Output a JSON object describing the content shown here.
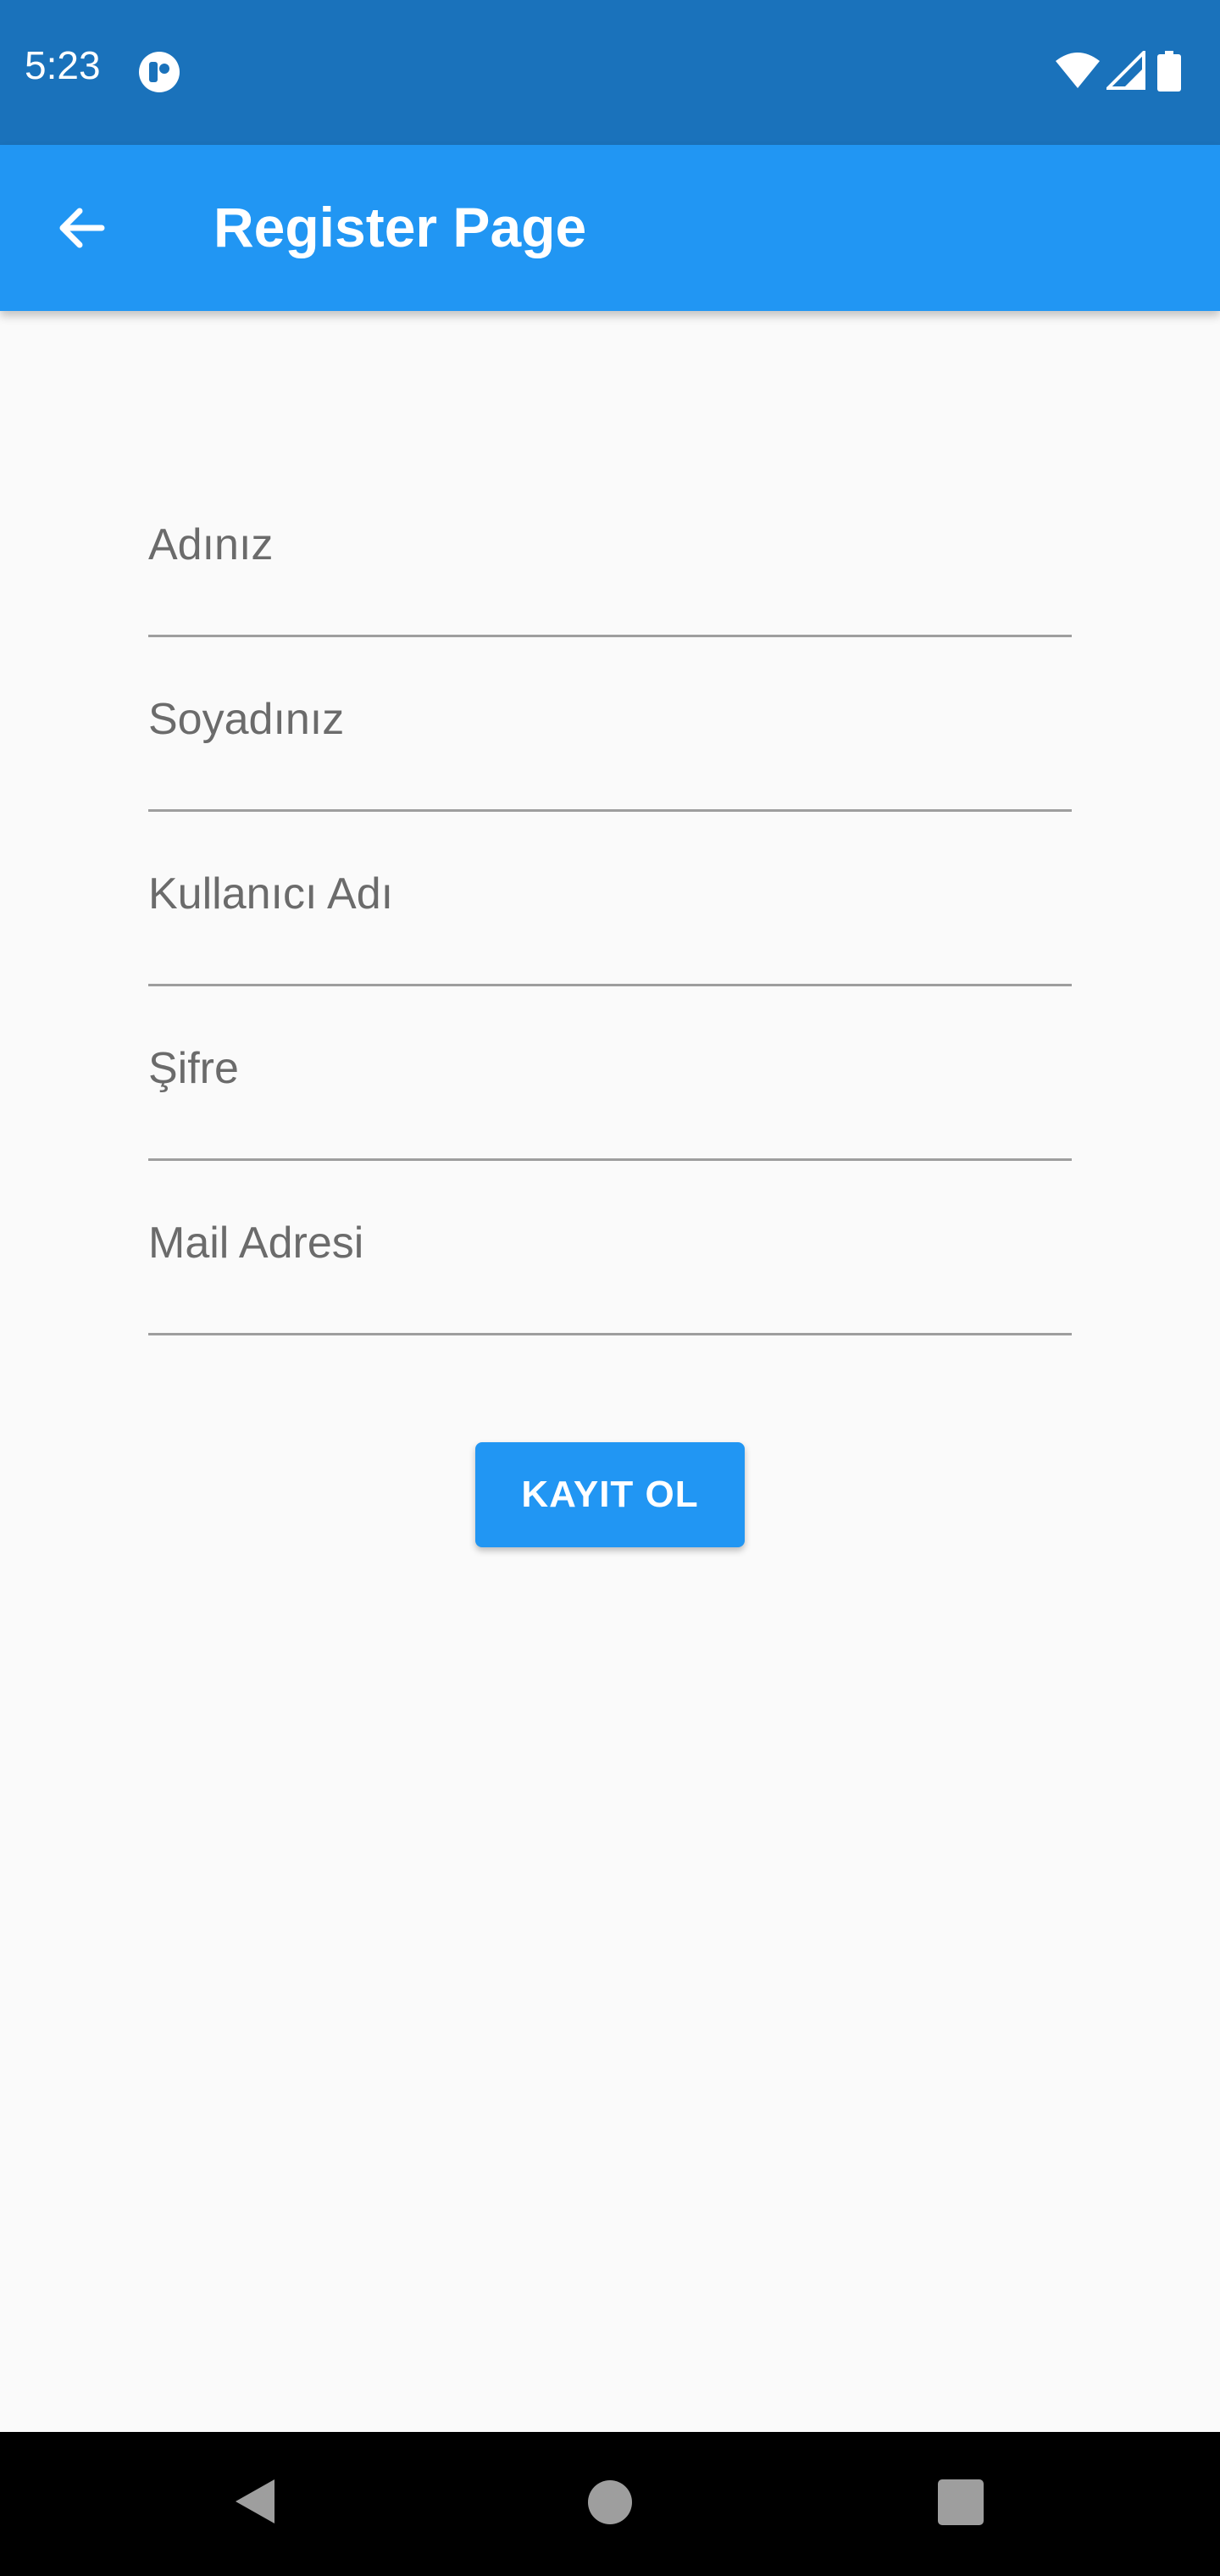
{
  "status_bar": {
    "time": "5:23",
    "app_icon": "notification-app-icon",
    "icons": [
      "wifi-icon",
      "cell-signal-icon",
      "battery-icon"
    ]
  },
  "app_bar": {
    "title": "Register Page",
    "back_icon": "arrow-back-icon"
  },
  "form": {
    "fields": [
      {
        "placeholder": "Adınız",
        "value": ""
      },
      {
        "placeholder": "Soyadınız",
        "value": ""
      },
      {
        "placeholder": "Kullanıcı Adı",
        "value": ""
      },
      {
        "placeholder": "Şifre",
        "value": ""
      },
      {
        "placeholder": "Mail Adresi",
        "value": ""
      }
    ],
    "submit_label": "KAYIT OL"
  },
  "nav_bar": {
    "icons": [
      "nav-back-icon",
      "nav-home-icon",
      "nav-recents-icon"
    ]
  },
  "colors": {
    "status_bar": "#1a72bb",
    "app_bar": "#2196f3",
    "background": "#fafafa",
    "button": "#2196f3"
  }
}
